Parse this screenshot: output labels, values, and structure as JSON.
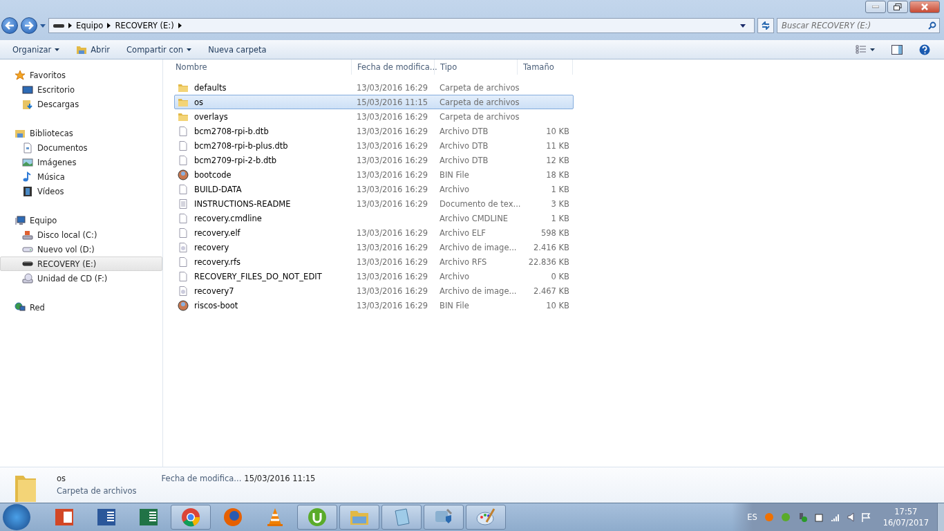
{
  "address": {
    "crumbs": [
      "Equipo",
      "RECOVERY (E:)"
    ]
  },
  "search": {
    "placeholder": "Buscar RECOVERY (E:)"
  },
  "commands": [
    {
      "label": "Organizar",
      "kind": "dropdown"
    },
    {
      "label": "Abrir",
      "kind": "open"
    },
    {
      "label": "Compartir con",
      "kind": "dropdown"
    },
    {
      "label": "Nueva carpeta",
      "kind": "plain"
    }
  ],
  "sidebar": [
    {
      "label": "Favoritos",
      "kind": "star",
      "children": [
        {
          "label": "Escritorio",
          "kind": "desktop",
          "selected": false
        },
        {
          "label": "Descargas",
          "kind": "downloads",
          "selected": false
        }
      ]
    },
    {
      "label": "Bibliotecas",
      "kind": "library",
      "children": [
        {
          "label": "Documentos",
          "kind": "document",
          "selected": false
        },
        {
          "label": "Imágenes",
          "kind": "picture",
          "selected": false
        },
        {
          "label": "Música",
          "kind": "music",
          "selected": false
        },
        {
          "label": "Vídeos",
          "kind": "video",
          "selected": false
        }
      ]
    },
    {
      "label": "Equipo",
      "kind": "computer",
      "children": [
        {
          "label": "Disco local (C:)",
          "kind": "system-drive",
          "selected": false
        },
        {
          "label": "Nuevo vol (D:)",
          "kind": "drive",
          "selected": false
        },
        {
          "label": "RECOVERY (E:)",
          "kind": "usb",
          "selected": true
        },
        {
          "label": "Unidad de CD (F:)",
          "kind": "cd",
          "selected": false
        }
      ]
    },
    {
      "label": "Red",
      "kind": "network"
    }
  ],
  "table": {
    "columns": [
      "Nombre",
      "Fecha de modifica...",
      "Tipo",
      "Tamaño"
    ],
    "rows": [
      {
        "name": "defaults",
        "date": "13/03/2016 16:29",
        "type": "Carpeta de archivos",
        "size": "",
        "kind": "folder",
        "selected": false
      },
      {
        "name": "os",
        "date": "15/03/2016 11:15",
        "type": "Carpeta de archivos",
        "size": "",
        "kind": "folder",
        "selected": true
      },
      {
        "name": "overlays",
        "date": "13/03/2016 16:29",
        "type": "Carpeta de archivos",
        "size": "",
        "kind": "folder",
        "selected": false
      },
      {
        "name": "bcm2708-rpi-b.dtb",
        "date": "13/03/2016 16:29",
        "type": "Archivo DTB",
        "size": "10 KB",
        "kind": "file",
        "selected": false
      },
      {
        "name": "bcm2708-rpi-b-plus.dtb",
        "date": "13/03/2016 16:29",
        "type": "Archivo DTB",
        "size": "11 KB",
        "kind": "file",
        "selected": false
      },
      {
        "name": "bcm2709-rpi-2-b.dtb",
        "date": "13/03/2016 16:29",
        "type": "Archivo DTB",
        "size": "12 KB",
        "kind": "file",
        "selected": false
      },
      {
        "name": "bootcode",
        "date": "13/03/2016 16:29",
        "type": "BIN File",
        "size": "18 KB",
        "kind": "disc",
        "selected": false
      },
      {
        "name": "BUILD-DATA",
        "date": "13/03/2016 16:29",
        "type": "Archivo",
        "size": "1 KB",
        "kind": "file",
        "selected": false
      },
      {
        "name": "INSTRUCTIONS-README",
        "date": "13/03/2016 16:29",
        "type": "Documento de tex...",
        "size": "3 KB",
        "kind": "text",
        "selected": false
      },
      {
        "name": "recovery.cmdline",
        "date": "",
        "type": "Archivo CMDLINE",
        "size": "1 KB",
        "kind": "file",
        "selected": false
      },
      {
        "name": "recovery.elf",
        "date": "13/03/2016 16:29",
        "type": "Archivo ELF",
        "size": "598 KB",
        "kind": "file",
        "selected": false
      },
      {
        "name": "recovery",
        "date": "13/03/2016 16:29",
        "type": "Archivo de image...",
        "size": "2.416 KB",
        "kind": "image",
        "selected": false
      },
      {
        "name": "recovery.rfs",
        "date": "13/03/2016 16:29",
        "type": "Archivo RFS",
        "size": "22.836 KB",
        "kind": "file",
        "selected": false
      },
      {
        "name": "RECOVERY_FILES_DO_NOT_EDIT",
        "date": "13/03/2016 16:29",
        "type": "Archivo",
        "size": "0 KB",
        "kind": "file",
        "selected": false
      },
      {
        "name": "recovery7",
        "date": "13/03/2016 16:29",
        "type": "Archivo de image...",
        "size": "2.467 KB",
        "kind": "image",
        "selected": false
      },
      {
        "name": "riscos-boot",
        "date": "13/03/2016 16:29",
        "type": "BIN File",
        "size": "10 KB",
        "kind": "disc",
        "selected": false
      }
    ]
  },
  "details": {
    "name": "os",
    "type": "Carpeta de archivos",
    "label": "Fecha de modifica...",
    "value": "15/03/2016 11:15"
  },
  "taskbar": {
    "apps": [
      {
        "kind": "slides",
        "open": false
      },
      {
        "kind": "wordproc",
        "open": false
      },
      {
        "kind": "sheet",
        "open": false
      },
      {
        "kind": "chrome",
        "open": true
      },
      {
        "kind": "firefox",
        "open": false
      },
      {
        "kind": "cone",
        "open": false
      },
      {
        "kind": "torrent",
        "open": true
      },
      {
        "kind": "explorer",
        "open": true
      },
      {
        "kind": "notepad",
        "open": true
      },
      {
        "kind": "tools",
        "open": true
      },
      {
        "kind": "paint",
        "open": true
      }
    ],
    "language": "ES",
    "time": "17:57",
    "date": "16/07/2017"
  }
}
